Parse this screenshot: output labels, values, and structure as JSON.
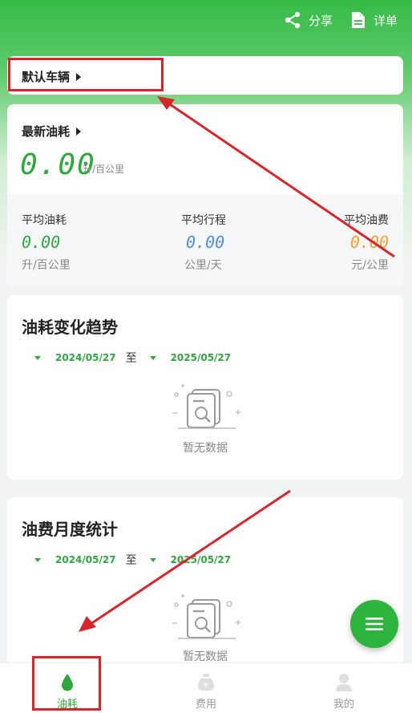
{
  "header": {
    "share_label": "分享",
    "detail_label": "详单"
  },
  "vehicle": {
    "label": "默认车辆"
  },
  "consumption": {
    "latest_title": "最新油耗",
    "latest_value": "0.00",
    "latest_unit": "升/百公里",
    "averages": [
      {
        "label": "平均油耗",
        "value": "0.00",
        "unit": "升/百公里",
        "color": "#2ea83e"
      },
      {
        "label": "平均行程",
        "value": "0.00",
        "unit": "公里/天",
        "color": "#4b8ee6"
      },
      {
        "label": "平均油费",
        "value": "0.00",
        "unit": "元/公里",
        "color": "#f0a132"
      }
    ]
  },
  "trend": {
    "title": "油耗变化趋势",
    "start_date": "2024/05/27",
    "separator": "至",
    "end_date": "2025/05/27",
    "empty_text": "暂无数据"
  },
  "monthly": {
    "title": "油费月度统计",
    "start_date": "2024/05/27",
    "separator": "至",
    "end_date": "2025/05/27",
    "empty_text": "暂无数据"
  },
  "nav": {
    "items": [
      {
        "label": "油耗",
        "icon": "drop-icon",
        "active": true
      },
      {
        "label": "费用",
        "icon": "money-bag-icon",
        "active": false
      },
      {
        "label": "我的",
        "icon": "person-icon",
        "active": false
      }
    ]
  },
  "colors": {
    "accent": "#2ea83e",
    "annotation": "#d7262b"
  }
}
